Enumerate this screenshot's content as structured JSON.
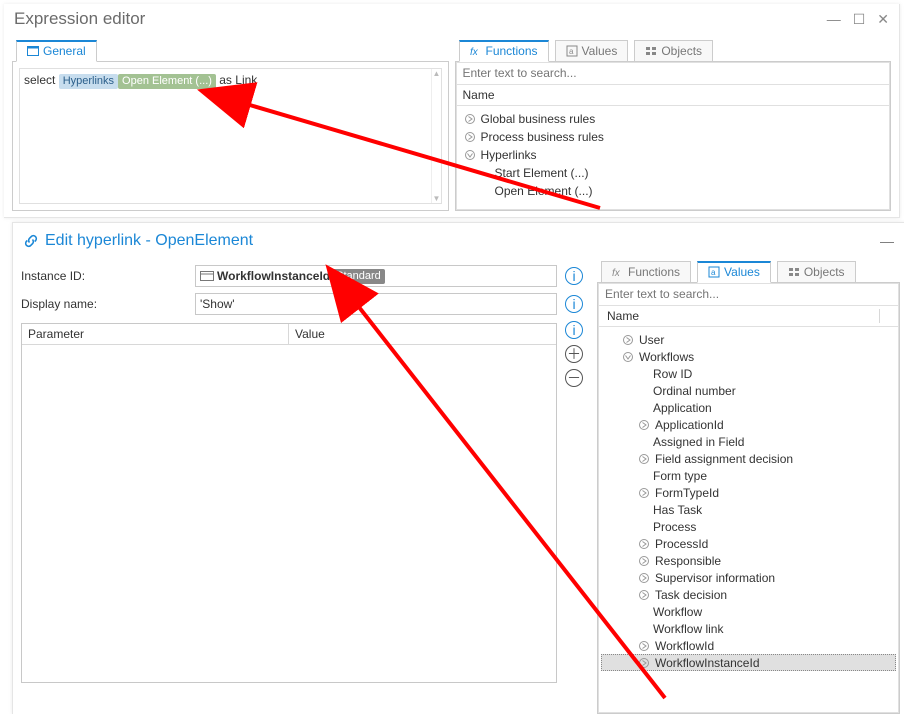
{
  "expression_editor": {
    "title": "Expression editor",
    "general_tab": "General",
    "code_prefix": "select ",
    "code_chip1": "Hyperlinks",
    "code_chip2": "Open Element (...)",
    "code_suffix": " as Link",
    "right_panel": {
      "tabs": {
        "functions": "Functions",
        "values": "Values",
        "objects": "Objects"
      },
      "search_placeholder": "Enter text to search...",
      "header": "Name",
      "rows": {
        "gbr": "Global business rules",
        "pbr": "Process business rules",
        "hyp": "Hyperlinks",
        "start": "Start Element (...)",
        "open": "Open Element (...)"
      }
    }
  },
  "edit_hyperlink": {
    "title": "Edit hyperlink - OpenElement",
    "labels": {
      "instance_id": "Instance ID:",
      "display_name": "Display name:"
    },
    "instance_id_text": "WorkflowInstanceId",
    "instance_id_badge": "Standard",
    "display_name_value": "'Show'",
    "ptable": {
      "col_param": "Parameter",
      "col_value": "Value"
    },
    "right_panel": {
      "tabs": {
        "functions": "Functions",
        "values": "Values",
        "objects": "Objects"
      },
      "search_placeholder": "Enter text to search...",
      "header": "Name",
      "rows": {
        "user": "User",
        "workflows": "Workflows",
        "row_id": "Row ID",
        "ordinal": "Ordinal number",
        "application": "Application",
        "application_id": "ApplicationId",
        "assigned": "Assigned in Field",
        "fad": "Field assignment decision",
        "form_type": "Form type",
        "form_type_id": "FormTypeId",
        "has_task": "Has Task",
        "process": "Process",
        "process_id": "ProcessId",
        "responsible": "Responsible",
        "supervisor": "Supervisor information",
        "task_dec": "Task decision",
        "workflow": "Workflow",
        "workflow_link": "Workflow link",
        "workflow_id": "WorkflowId",
        "workflow_instance_id": "WorkflowInstanceId"
      }
    }
  }
}
